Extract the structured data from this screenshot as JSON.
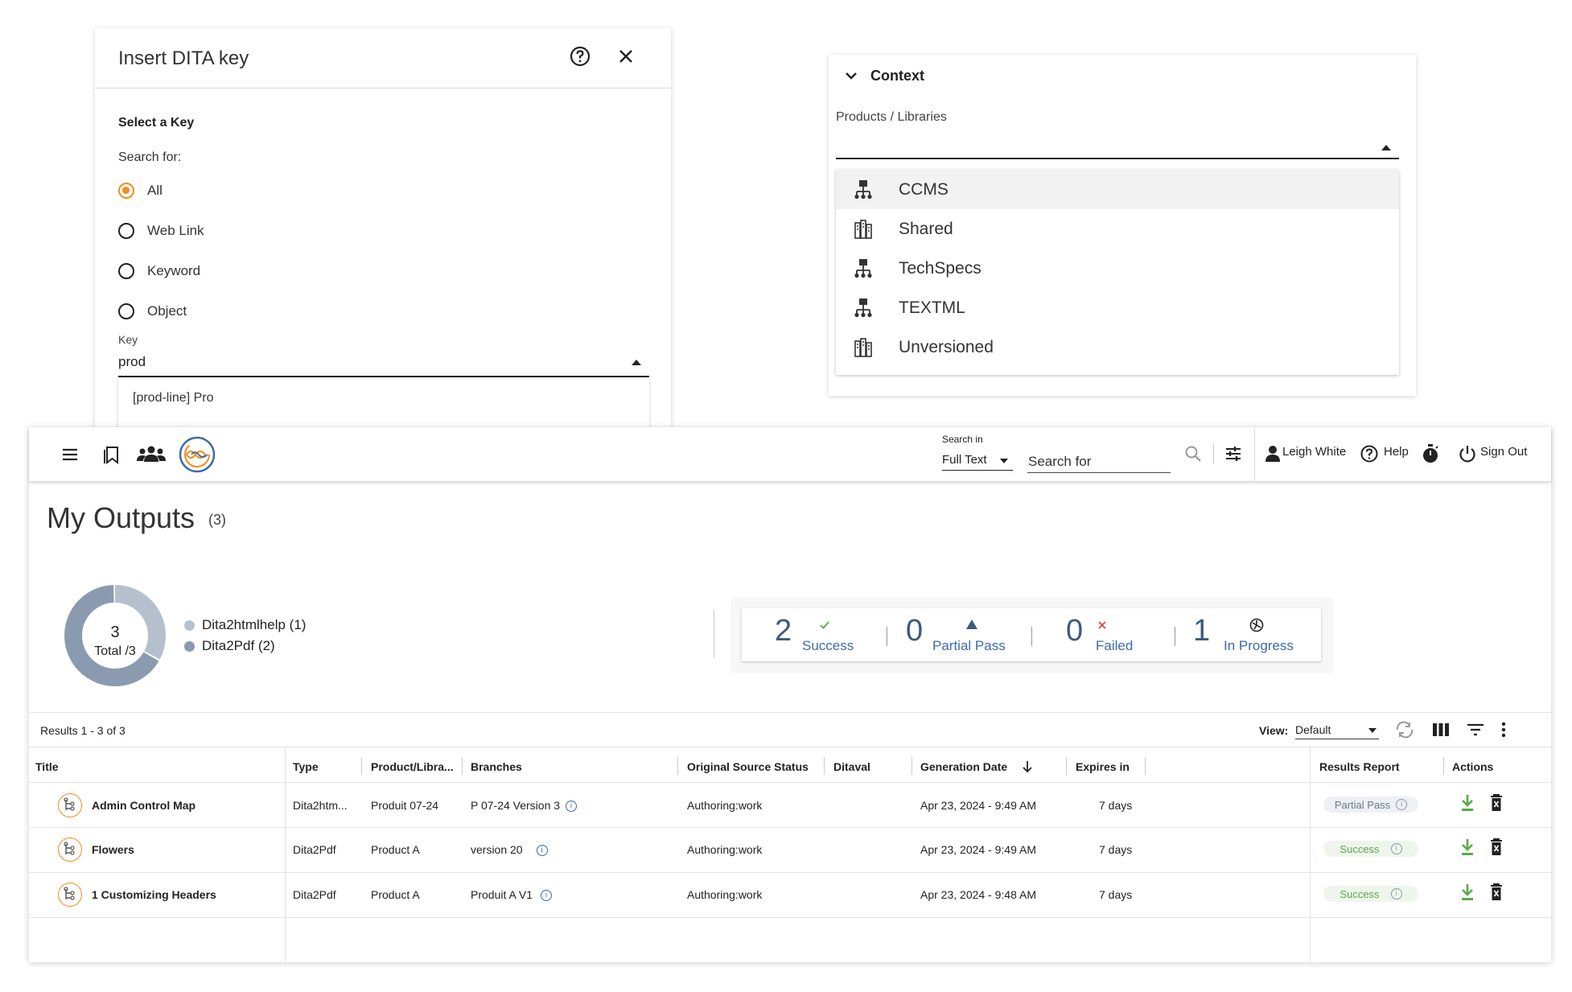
{
  "dialog": {
    "title": "Insert DITA key",
    "section_label": "Select a Key",
    "search_for_label": "Search for:",
    "radio_options": [
      {
        "label": "All",
        "selected": true
      },
      {
        "label": "Web Link",
        "selected": false
      },
      {
        "label": "Keyword",
        "selected": false
      },
      {
        "label": "Object",
        "selected": false
      }
    ],
    "key_label": "Key",
    "key_value": "prod",
    "key_suggestions": [
      "[prod-line] Pro"
    ]
  },
  "context_panel": {
    "title": "Context",
    "field_label": "Products / Libraries",
    "libraries": [
      {
        "label": "CCMS",
        "icon": "product-tree-icon",
        "highlighted": true
      },
      {
        "label": "Shared",
        "icon": "library-icon",
        "highlighted": false
      },
      {
        "label": "TechSpecs",
        "icon": "product-tree-icon",
        "highlighted": false
      },
      {
        "label": "TEXTML",
        "icon": "product-tree-icon",
        "highlighted": false
      },
      {
        "label": "Unversioned",
        "icon": "library-icon",
        "highlighted": false
      }
    ]
  },
  "topbar": {
    "search_in_label": "Search in",
    "search_in_value": "Full Text",
    "search_placeholder": "Search for",
    "user_name": "Leigh White",
    "help_label": "Help",
    "signout_label": "Sign Out"
  },
  "page": {
    "title": "My Outputs",
    "count": "(3)"
  },
  "summary": {
    "donut_total": "3",
    "donut_sublabel": "Total /3",
    "legend": [
      {
        "label": "Dita2htmlhelp (1)",
        "value": 1,
        "color": "#b4c0cd"
      },
      {
        "label": "Dita2Pdf (2)",
        "value": 2,
        "color": "#8a9bb0"
      }
    ],
    "stats": [
      {
        "value": "2",
        "label": "Success",
        "icon": "check-icon"
      },
      {
        "value": "0",
        "label": "Partial Pass",
        "icon": "warning-triangle-icon"
      },
      {
        "value": "0",
        "label": "Failed",
        "icon": "x-icon"
      },
      {
        "value": "1",
        "label": "In Progress",
        "icon": "spinner-icon"
      }
    ]
  },
  "results": {
    "summary_text": "Results 1 - 3 of 3",
    "view_label": "View:",
    "view_value": "Default",
    "columns": [
      "Title",
      "Type",
      "Product/Libra...",
      "Branches",
      "Original Source Status",
      "Ditaval",
      "Generation Date",
      "Expires in",
      "Results Report",
      "Actions"
    ],
    "rows": [
      {
        "title": "Admin Control Map",
        "type": "Dita2htm...",
        "product": "Produit 07-24",
        "branch": "P 07-24 Version 3",
        "status": "Authoring:work",
        "ditaval": "",
        "date": "Apr 23, 2024 - 9:49 AM",
        "expires": "7 days",
        "report": "Partial Pass"
      },
      {
        "title": "Flowers",
        "type": "Dita2Pdf",
        "product": "Product A",
        "branch": "version 20",
        "status": "Authoring:work",
        "ditaval": "",
        "date": "Apr 23, 2024 - 9:49 AM",
        "expires": "7 days",
        "report": "Success"
      },
      {
        "title": "1 Customizing Headers",
        "type": "Dita2Pdf",
        "product": "Product A",
        "branch": "Produit A V1",
        "status": "Authoring:work",
        "ditaval": "",
        "date": "Apr 23, 2024 - 9:48 AM",
        "expires": "7 days",
        "report": "Success"
      }
    ]
  },
  "colors": {
    "accent_orange": "#f08c1e",
    "stat_blue": "#3d6aa8",
    "success_green": "#5ba84a",
    "failed_red": "#d64545"
  }
}
